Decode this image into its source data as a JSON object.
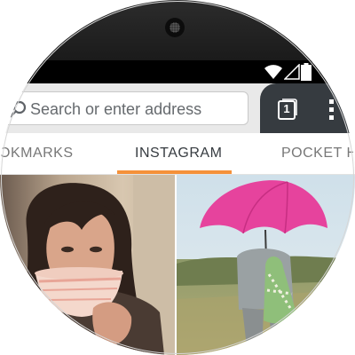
{
  "browser": {
    "urlbar": {
      "placeholder": "Search or enter address"
    },
    "tabs": {
      "count": "1"
    }
  },
  "panels": {
    "tabs": [
      {
        "label": "OKMARKS",
        "active": false
      },
      {
        "label": "INSTAGRAM",
        "active": true
      },
      {
        "label": "POCKET HI",
        "active": false
      }
    ],
    "accent_color": "#f5913a"
  },
  "icons": {
    "status": [
      "wifi-icon",
      "signal-icon",
      "battery-icon"
    ],
    "toolbar": [
      "search-icon",
      "tabs-icon",
      "menu-icon"
    ]
  },
  "photos": [
    {
      "subject": "woman-drinking-from-cup"
    },
    {
      "subject": "person-with-pink-umbrella"
    }
  ]
}
